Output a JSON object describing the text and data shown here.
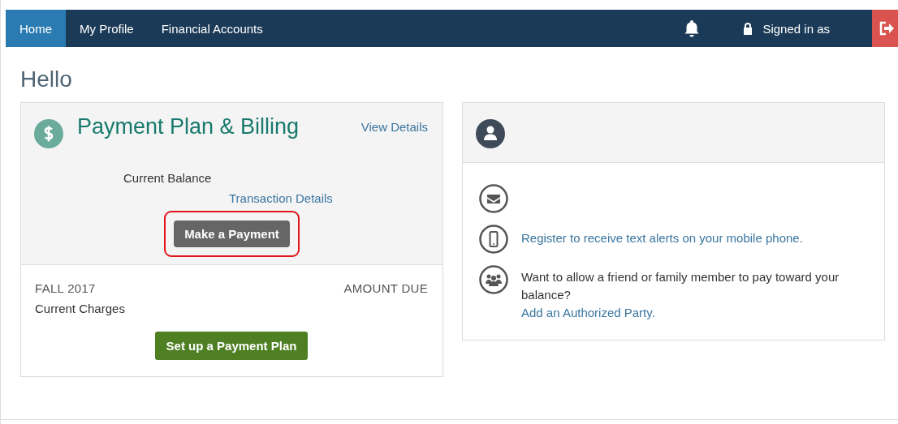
{
  "nav": {
    "tabs": [
      {
        "label": "Home",
        "selected": true
      },
      {
        "label": "My Profile",
        "selected": false
      },
      {
        "label": "Financial Accounts",
        "selected": false
      }
    ],
    "signed_in": "Signed in as"
  },
  "greeting": "Hello",
  "billing": {
    "title": "Payment Plan & Billing",
    "view_link": "View Details",
    "balance_label": "Current Balance",
    "transactions_link": "Transaction Details",
    "pay_button": {
      "label": "Make a Payment",
      "highlighted": true
    },
    "term": "FALL 2017",
    "amount_due": "AMOUNT DUE",
    "charges": "Current Charges",
    "plan_button": "Set up a Payment Plan"
  },
  "profile": {
    "items": [
      {
        "kind": "email"
      },
      {
        "kind": "phone",
        "link": "Register to receive text alerts on your mobile phone."
      },
      {
        "kind": "group",
        "text": "Want to allow a friend or family member to pay toward your balance?",
        "link": "Add an Authorized Party."
      }
    ]
  }
}
